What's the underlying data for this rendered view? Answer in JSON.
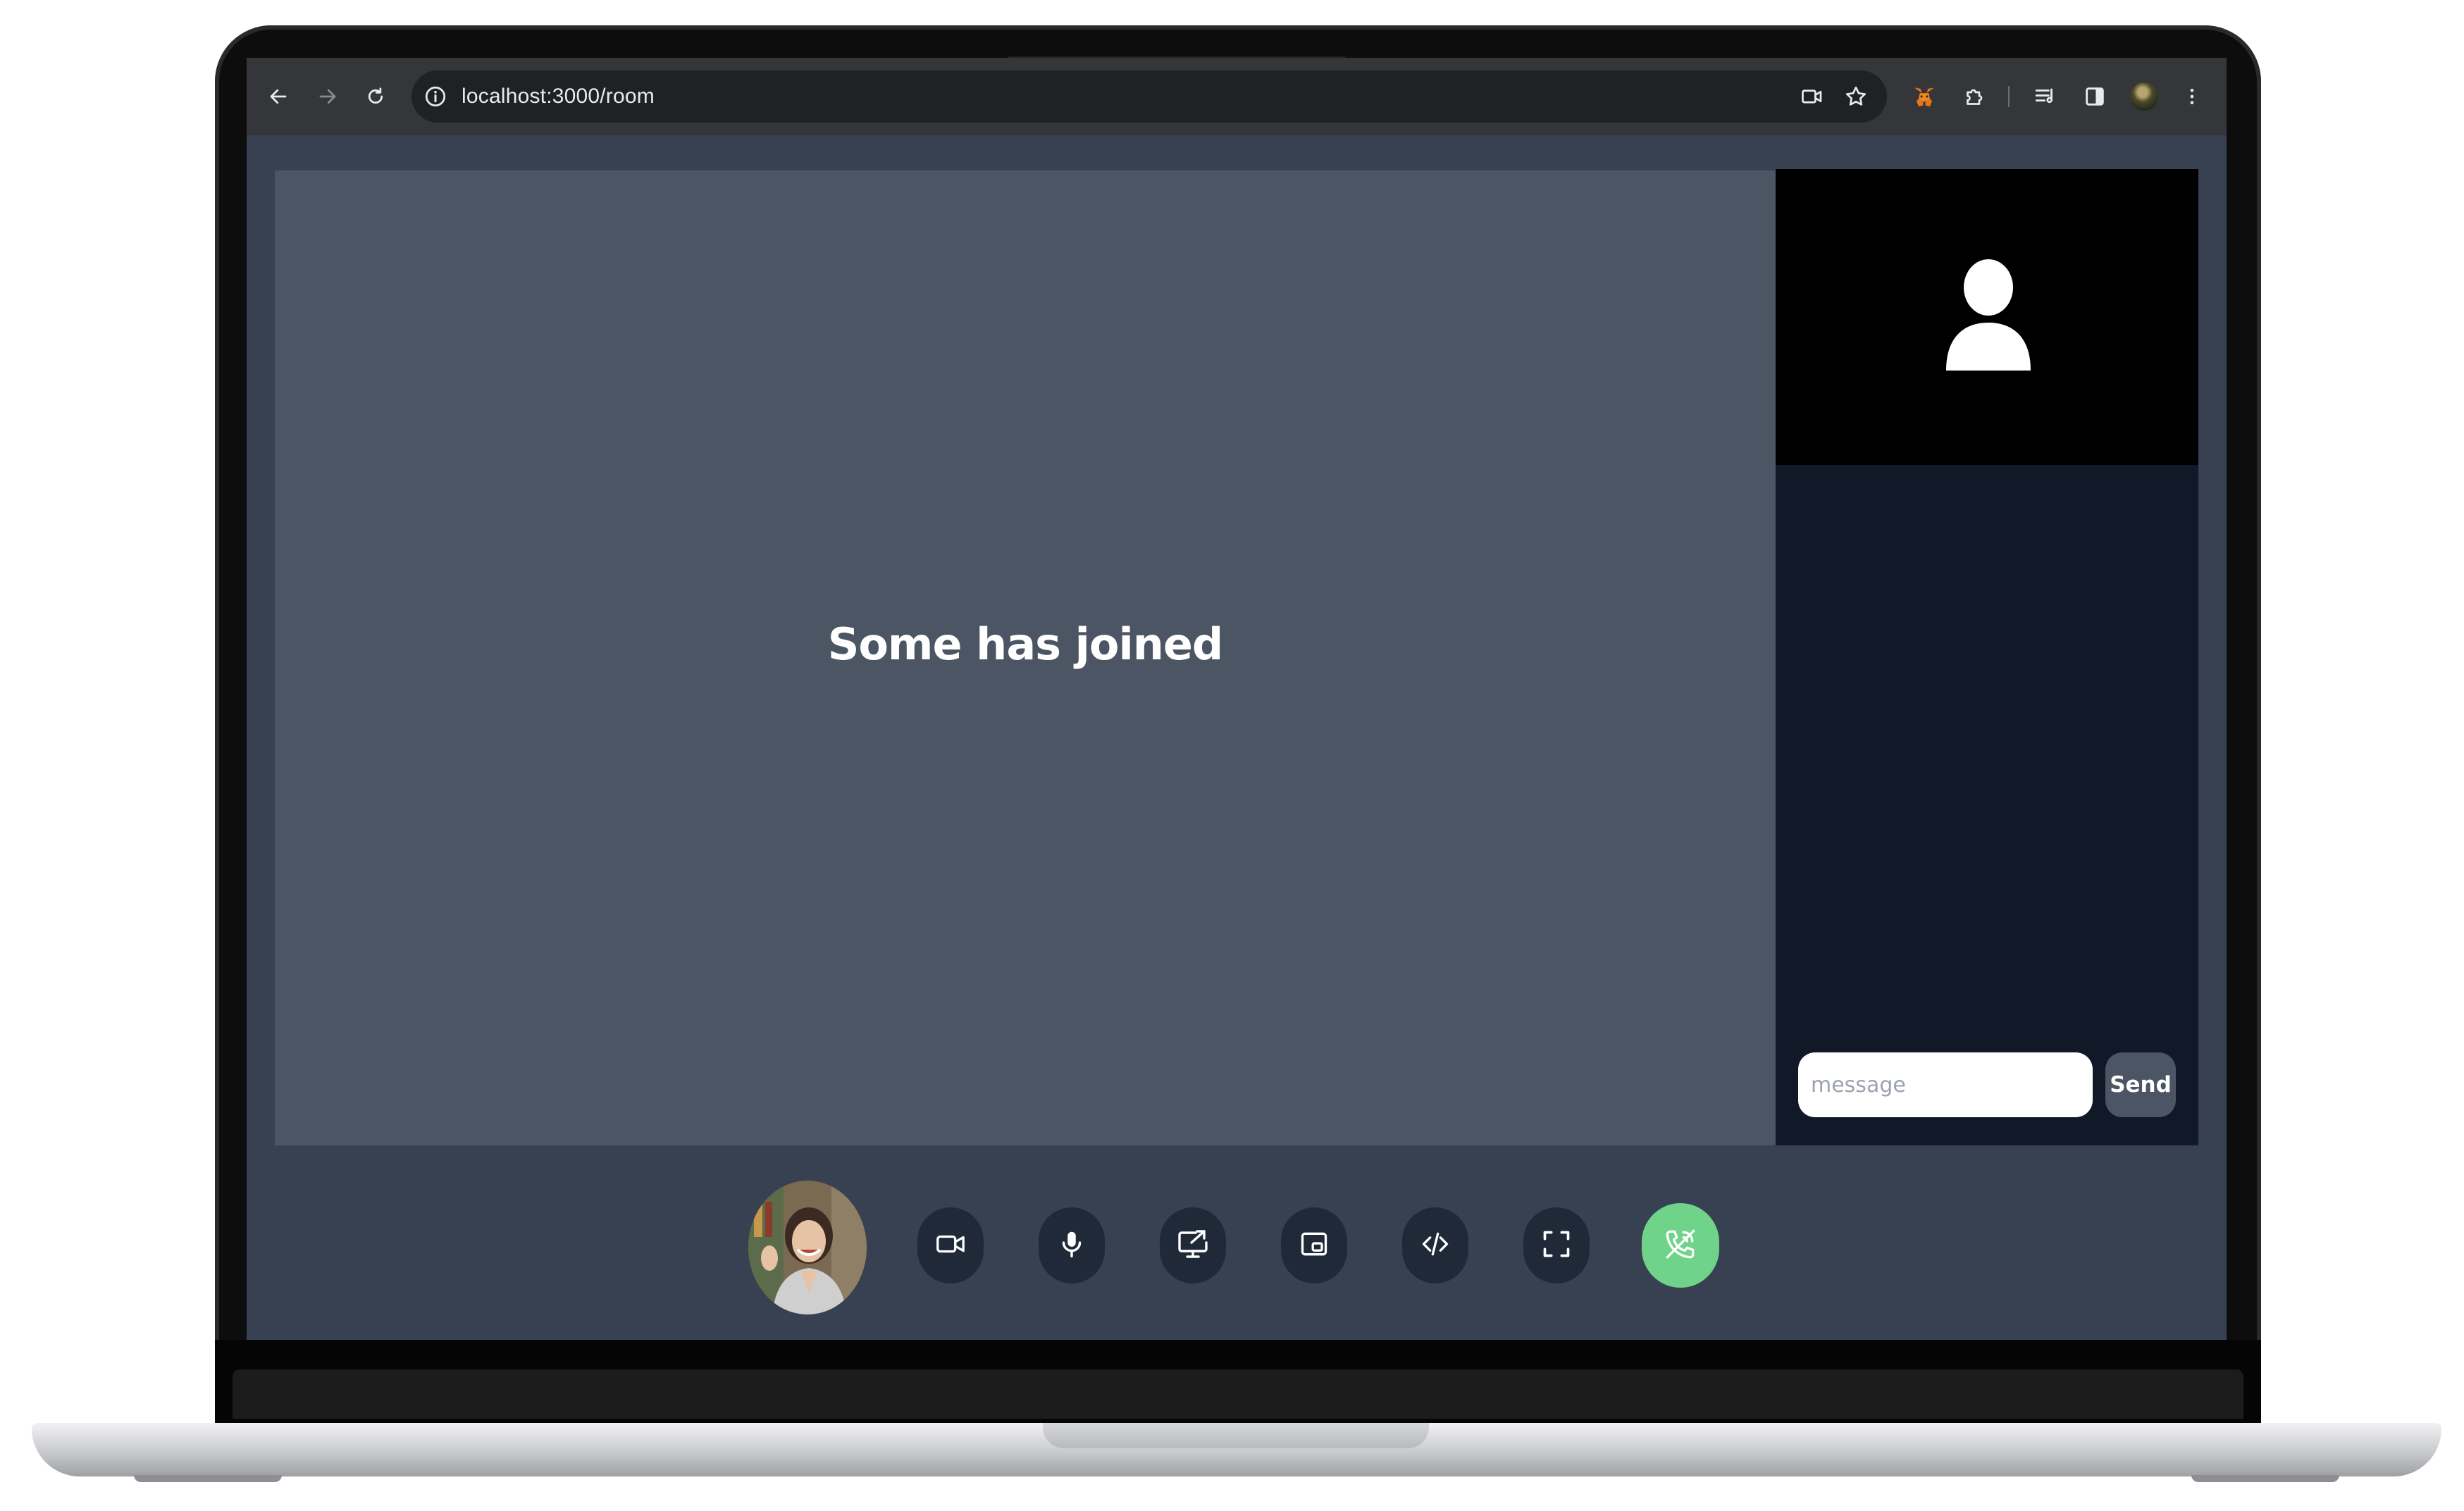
{
  "browser": {
    "url": "localhost:3000/room",
    "nav_icons": [
      "back-arrow-icon",
      "forward-arrow-icon",
      "reload-icon"
    ],
    "site_info_icon": "info-icon",
    "right_icons": [
      "camera-in-use-icon",
      "bookmark-star-icon",
      "metamask-extension-icon",
      "extensions-puzzle-icon",
      "reading-list-icon",
      "side-panel-icon",
      "profile-avatar",
      "menu-kebab-icon"
    ]
  },
  "stage": {
    "status_text": "Some has joined"
  },
  "sidepanel": {
    "remote_placeholder_icon": "person-icon",
    "chat": {
      "input_placeholder": "message",
      "input_value": "",
      "send_label": "Send"
    }
  },
  "controls": {
    "buttons": [
      "camera-icon",
      "microphone-icon",
      "screen-share-icon",
      "picture-in-picture-icon",
      "code-icon",
      "fullscreen-icon",
      "end-call-phone-icon"
    ],
    "end_call_color": "#6fd38a"
  },
  "colors": {
    "app_bg": "#374151",
    "stage_bg": "#4b5563",
    "sidepanel_bg": "#111827",
    "control_button_bg": "#1f2937"
  }
}
